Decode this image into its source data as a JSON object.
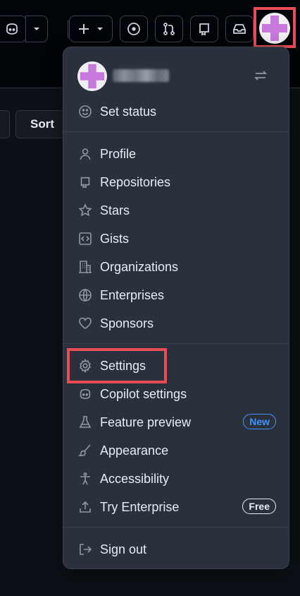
{
  "topbar": {
    "icons": [
      "copilot-icon",
      "chevron-down-icon",
      "plus-icon",
      "chevron-down-icon",
      "issue-icon",
      "pull-request-icon",
      "repo-icon",
      "inbox-icon"
    ]
  },
  "page": {
    "sort_label": "Sort"
  },
  "menu": {
    "status": "Set status",
    "items": [
      {
        "label": "Profile",
        "icon": "person-icon"
      },
      {
        "label": "Repositories",
        "icon": "repo-icon"
      },
      {
        "label": "Stars",
        "icon": "star-icon"
      },
      {
        "label": "Gists",
        "icon": "code-square-icon"
      },
      {
        "label": "Organizations",
        "icon": "organization-icon"
      },
      {
        "label": "Enterprises",
        "icon": "globe-icon"
      },
      {
        "label": "Sponsors",
        "icon": "heart-icon"
      },
      {
        "label": "Settings",
        "icon": "gear-icon"
      },
      {
        "label": "Copilot settings",
        "icon": "copilot-icon"
      },
      {
        "label": "Feature preview",
        "icon": "beaker-icon",
        "badge": "New"
      },
      {
        "label": "Appearance",
        "icon": "paintbrush-icon"
      },
      {
        "label": "Accessibility",
        "icon": "accessibility-icon"
      },
      {
        "label": "Try Enterprise",
        "icon": "upload-icon",
        "badge": "Free"
      },
      {
        "label": "Sign out",
        "icon": "sign-out-icon"
      }
    ]
  },
  "colors": {
    "highlight": "#ea4c55",
    "avatar_purple": "#c678dd",
    "badge_new": "#4493f8"
  }
}
